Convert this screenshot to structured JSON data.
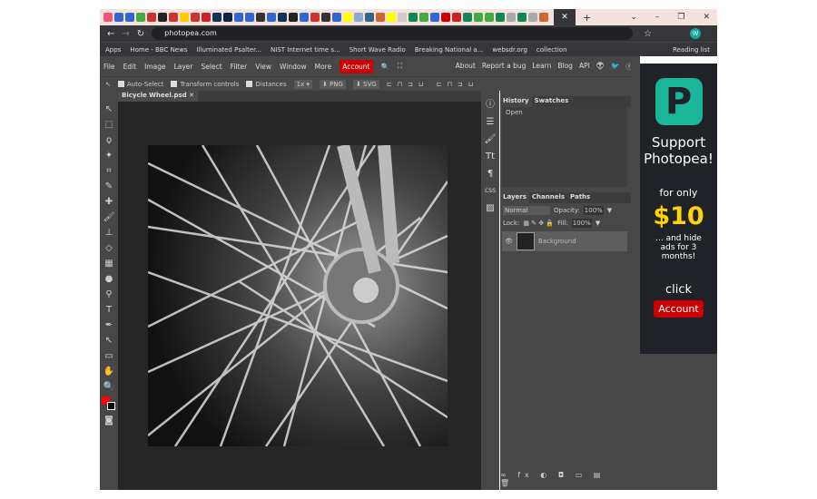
{
  "browser": {
    "url": "photopea.com",
    "bookmarks": [
      "Apps",
      "Home - BBC News",
      "Illuminated Psalter...",
      "NIST Internet time s...",
      "Short Wave Radio",
      "Breaking National a...",
      "websdr.org",
      "collection"
    ],
    "reading_list": "Reading list",
    "profile": "W",
    "tab_colors": [
      "#e57",
      "#36c",
      "#36c",
      "#4a4",
      "#c33",
      "#222",
      "#c33",
      "#fc0",
      "#c33",
      "#c22",
      "#135",
      "#124",
      "#36c",
      "#36c",
      "#333",
      "#36c",
      "#135",
      "#222",
      "#36c",
      "#c33",
      "#333",
      "#36c",
      "#ff0",
      "#8ac",
      "#368",
      "#c63",
      "#ff0",
      "#ccc",
      "#185",
      "#4a4",
      "#36c",
      "#c00",
      "#c22",
      "#185",
      "#4a4",
      "#4a4",
      "#185",
      "#aaa",
      "#185",
      "#aaa",
      "#c63"
    ]
  },
  "menu": {
    "items": [
      "File",
      "Edit",
      "Image",
      "Layer",
      "Select",
      "Filter",
      "View",
      "Window",
      "More"
    ],
    "account": "Account",
    "right": [
      "About",
      "Report a bug",
      "Learn",
      "Blog",
      "API"
    ]
  },
  "options": {
    "auto_select": "Auto-Select",
    "transform": "Transform controls",
    "distances": "Distances",
    "scale": "1x ▾",
    "png": "⬇ PNG",
    "svg": "⬇ SVG"
  },
  "document": {
    "tab": "Bicycle Wheel.psd"
  },
  "history": {
    "tabs": [
      "History",
      "Swatches"
    ],
    "items": [
      "Open"
    ]
  },
  "layers": {
    "tabs": [
      "Layers",
      "Channels",
      "Paths"
    ],
    "blend": "Normal",
    "opacity_label": "Opacity:",
    "opacity": "100%",
    "lock_label": "Lock:",
    "fill_label": "Fill:",
    "fill": "100%",
    "layer_name": "Background"
  },
  "ad": {
    "line1": "Support",
    "line2": "Photopea!",
    "for_only": "for only",
    "price": "$10",
    "hide": "... and hide ads for 3 months!",
    "click": "click",
    "account": "Account",
    "accent": "#ffd400",
    "logo_color": "#1bb79a"
  }
}
